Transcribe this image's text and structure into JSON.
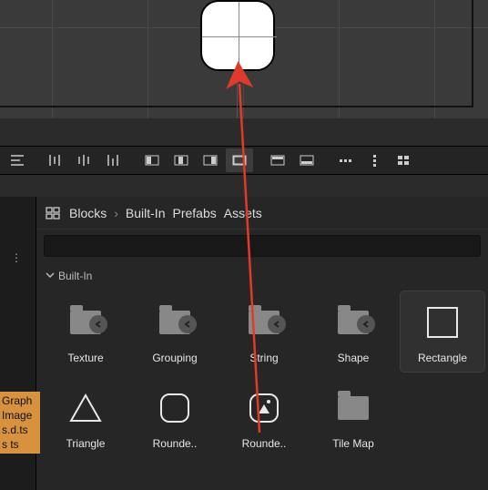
{
  "breadcrumb": {
    "root": "Blocks",
    "segments": [
      "Built-In",
      "Prefabs",
      "Assets"
    ]
  },
  "section": {
    "title": "Built-In"
  },
  "tiles_row1": [
    {
      "label": "Texture",
      "kind": "folder"
    },
    {
      "label": "Grouping",
      "kind": "folder"
    },
    {
      "label": "String",
      "kind": "folder"
    },
    {
      "label": "Shape",
      "kind": "folder"
    },
    {
      "label": "Rectangle",
      "kind": "rect"
    }
  ],
  "tiles_row2": [
    {
      "label": "Triangle",
      "kind": "triangle"
    },
    {
      "label": "Rounde..",
      "kind": "roundrect"
    },
    {
      "label": "Rounde..",
      "kind": "roundrect-img"
    },
    {
      "label": "Tile Map",
      "kind": "folder-plain"
    }
  ],
  "orange_lines": [
    "Graph",
    "Image",
    "s.d.ts",
    "s ts"
  ],
  "toolbar_icons": [
    "align-lines",
    "dist-h-1",
    "dist-h-2",
    "dist-h-3",
    "box-left",
    "box-center",
    "box-right",
    "box-sel",
    "row-top",
    "row-bottom",
    "dots-h",
    "dots-v",
    "grid"
  ]
}
